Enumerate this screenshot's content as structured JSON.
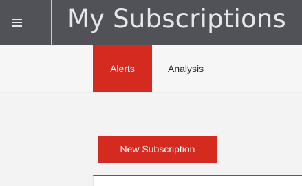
{
  "header": {
    "menu_icon": "hamburger-menu-icon",
    "title": "My Subscriptions"
  },
  "tabs": [
    {
      "label": "Alerts",
      "active": true
    },
    {
      "label": "Analysis",
      "active": false
    }
  ],
  "actions": {
    "new_subscription_label": "New Subscription"
  },
  "colors": {
    "header_bg": "#505257",
    "accent": "#d42a20",
    "tabbar_bg": "#f6f6f6",
    "content_bg": "#f3f3f3"
  }
}
